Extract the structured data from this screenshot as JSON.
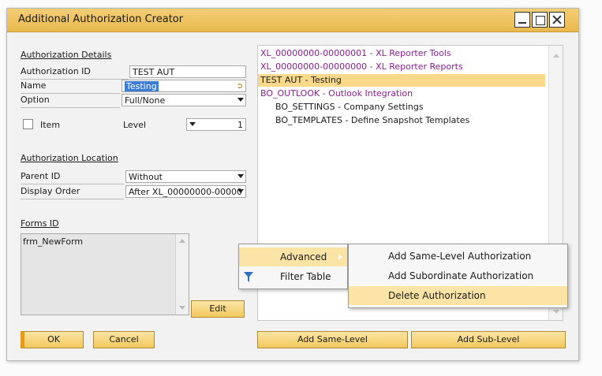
{
  "window": {
    "title": "Additional Authorization Creator"
  },
  "details": {
    "section_label": "Authorization Details",
    "authorization_id_label": "Authorization ID",
    "authorization_id_value": "TEST AUT",
    "name_label": "Name",
    "name_value": "Testing",
    "option_label": "Option",
    "option_value": "Full/None",
    "item_label": "Item",
    "level_label": "Level",
    "level_value": "1"
  },
  "location": {
    "section_label": "Authorization Location",
    "parent_id_label": "Parent ID",
    "parent_id_value": "Without",
    "display_order_label": "Display Order",
    "display_order_value": "After XL_00000000-00000"
  },
  "forms": {
    "section_label": "Forms ID",
    "items": [
      "frm_NewForm"
    ],
    "edit_button": "Edit"
  },
  "buttons": {
    "ok": "OK",
    "cancel": "Cancel",
    "add_same_level": "Add Same-Level",
    "add_sub_level": "Add Sub-Level"
  },
  "tree": {
    "items": [
      {
        "label": "XL_00000000-00000001 - XL Reporter Tools",
        "style": "purple"
      },
      {
        "label": "XL_00000000-00000000 - XL Reporter Reports",
        "style": "purple"
      },
      {
        "label": "TEST AUT - Testing",
        "style": "selected"
      },
      {
        "label": "BO_OUTLOOK - Outlook Integration",
        "style": "purple"
      },
      {
        "label": "BO_SETTINGS - Company Settings",
        "style": "child"
      },
      {
        "label": "BO_TEMPLATES - Define Snapshot Templates",
        "style": "child"
      }
    ]
  },
  "context_menu": {
    "items": [
      "Advanced",
      "Filter Table"
    ],
    "icon": "filter-icon"
  },
  "submenu": {
    "items": [
      "Add Same-Level Authorization",
      "Add Subordinate Authorization",
      "Delete Authorization"
    ]
  },
  "colors": {
    "title_bar": "#eec35f",
    "tree_parent_text": "#8a1f8f",
    "selection": "#fbd98a",
    "menu_hover": "#fbe4a6",
    "button": "#f5d276"
  }
}
